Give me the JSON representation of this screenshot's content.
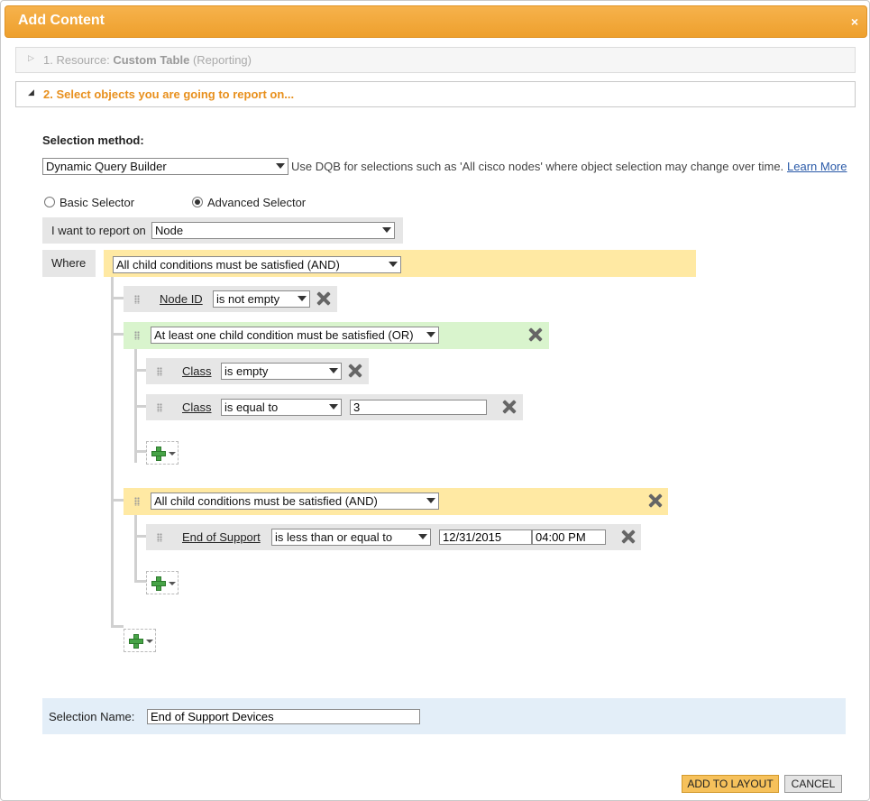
{
  "dialog": {
    "title": "Add Content",
    "close": "×"
  },
  "steps": [
    {
      "num": "1. Resource:",
      "name": "Custom Table",
      "note": "(Reporting)"
    },
    {
      "label": "2. Select objects you are going to report on..."
    }
  ],
  "selection": {
    "method_label": "Selection method:",
    "method_value": "Dynamic Query Builder",
    "method_hint": "Use DQB for selections such as 'All cisco nodes' where object selection may change over time.",
    "learn_more": "Learn More",
    "radio_basic": "Basic Selector",
    "radio_advanced": "Advanced Selector",
    "selected_radio": "advanced",
    "report_on_label": "I want to report on",
    "report_on_value": "Node",
    "where_label": "Where",
    "root_group": "All child conditions must be satisfied (AND)"
  },
  "conditions": {
    "c1": {
      "field": "Node ID",
      "op": "is not empty"
    },
    "or_group": "At least one child condition must be satisfied (OR)",
    "c2": {
      "field": "Class",
      "op": "is empty"
    },
    "c3": {
      "field": "Class",
      "op": "is equal to",
      "value": "3"
    },
    "and_group": "All child conditions must be satisfied (AND)",
    "c4": {
      "field": "End of Support",
      "op": "is less than or equal to",
      "date": "12/31/2015",
      "time": "04:00 PM"
    }
  },
  "name_row": {
    "label": "Selection Name:",
    "value": "End of Support Devices"
  },
  "buttons": {
    "add": "ADD TO LAYOUT",
    "cancel": "CANCEL"
  },
  "colors": {
    "accent": "#f0a535",
    "and_group": "#ffe9a3",
    "or_group": "#d9f4cd",
    "name_bar": "#e3eef8"
  }
}
